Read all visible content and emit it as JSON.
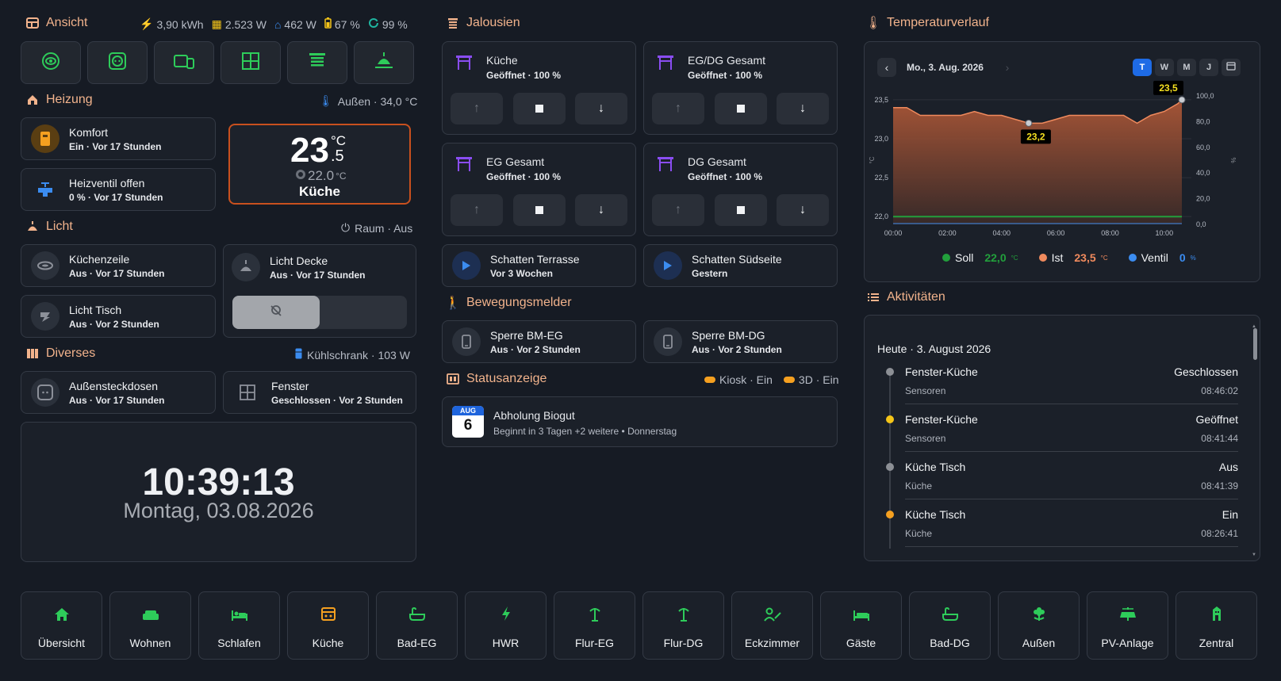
{
  "view": {
    "title": "Ansicht",
    "stats": [
      {
        "icon": "solar-energy-icon",
        "value": "3,90 kWh"
      },
      {
        "icon": "solar-panel-icon",
        "value": "2.523 W"
      },
      {
        "icon": "house-power-icon",
        "value": "462 W"
      },
      {
        "icon": "battery-icon",
        "value": "67 %"
      },
      {
        "icon": "ring-progress-icon",
        "value": "99 %"
      }
    ],
    "buttons": [
      "eye-icon",
      "socket-icon",
      "devices-icon",
      "window-icon",
      "blinds-icon",
      "ceiling-lamp-icon"
    ]
  },
  "heating": {
    "title": "Heizung",
    "outside": "Außen · 34,0 °C",
    "comfort": {
      "name": "Komfort",
      "state": "Ein · Vor 17 Stunden"
    },
    "valve": {
      "name": "Heizventil offen",
      "state": "0 % · Vor 17 Stunden"
    },
    "thermostat": {
      "temp_int": "23",
      "temp_dec": ".5",
      "unit": "°C",
      "target": "22.0",
      "target_unit": "°C",
      "room": "Küche"
    }
  },
  "light": {
    "title": "Licht",
    "room_state": "Raum · Aus",
    "kitchen_row": {
      "name": "Küchenzeile",
      "state": "Aus · Vor 17 Stunden"
    },
    "table": {
      "name": "Licht Tisch",
      "state": "Aus · Vor 2 Stunden"
    },
    "ceiling": {
      "name": "Licht Decke",
      "state": "Aus · Vor 17 Stunden"
    }
  },
  "misc": {
    "title": "Diverses",
    "fridge": "Kühlschrank · 103 W",
    "outlets": {
      "name": "Außensteckdosen",
      "state": "Aus · Vor 17 Stunden"
    },
    "window": {
      "name": "Fenster",
      "state": "Geschlossen · Vor 2 Stunden"
    }
  },
  "clock": {
    "time": "10:39:13",
    "date": "Montag, 03.08.2026"
  },
  "blinds": {
    "title": "Jalousien",
    "items": [
      {
        "name": "Küche",
        "state": "Geöffnet · 100 %"
      },
      {
        "name": "EG/DG Gesamt",
        "state": "Geöffnet · 100 %"
      },
      {
        "name": "EG Gesamt",
        "state": "Geöffnet · 100 %"
      },
      {
        "name": "DG Gesamt",
        "state": "Geöffnet · 100 %"
      }
    ],
    "scenes": [
      {
        "name": "Schatten Terrasse",
        "state": "Vor 3 Wochen"
      },
      {
        "name": "Schatten Südseite",
        "state": "Gestern"
      }
    ]
  },
  "motion": {
    "title": "Bewegungsmelder",
    "items": [
      {
        "name": "Sperre BM-EG",
        "state": "Aus · Vor 2 Stunden"
      },
      {
        "name": "Sperre BM-DG",
        "state": "Aus · Vor 2 Stunden"
      }
    ]
  },
  "status": {
    "title": "Statusanzeige",
    "kiosk": "Kiosk · Ein",
    "threed": "3D · Ein",
    "event": {
      "month": "AUG",
      "day": "6",
      "title": "Abholung Biogut",
      "detail": "Beginnt in 3 Tagen +2 weitere • Donnerstag"
    }
  },
  "temperature": {
    "title": "Temperaturverlauf",
    "date": "Mo., 3. Aug. 2026",
    "ranges": [
      "T",
      "W",
      "M",
      "J"
    ],
    "active_range": "T",
    "legend": [
      {
        "name": "Soll",
        "value": "22,0",
        "unit": "°C",
        "color": "#22a03c"
      },
      {
        "name": "Ist",
        "value": "23,5",
        "unit": "°C",
        "color": "#f08a5d"
      },
      {
        "name": "Ventil",
        "value": "0",
        "unit": "%",
        "color": "#3b8cf0"
      }
    ]
  },
  "chart_data": {
    "type": "area",
    "x": [
      "00:00",
      "00:30",
      "01:00",
      "01:30",
      "02:00",
      "02:30",
      "03:00",
      "03:30",
      "04:00",
      "04:30",
      "05:00",
      "05:30",
      "06:00",
      "06:30",
      "07:00",
      "07:30",
      "08:00",
      "08:30",
      "09:00",
      "09:30",
      "10:00",
      "10:30",
      "10:39"
    ],
    "xticks": [
      "00:00",
      "02:00",
      "04:00",
      "06:00",
      "08:00",
      "10:00"
    ],
    "ylim": [
      21.9,
      23.55
    ],
    "yticks": [
      "22,0",
      "22,5",
      "23,0",
      "23,5"
    ],
    "ylabel": "°C",
    "y2lim": [
      0,
      100
    ],
    "y2ticks": [
      "0,0",
      "20,0",
      "40,0",
      "60,0",
      "80,0",
      "100,0"
    ],
    "y2label": "%",
    "series": [
      {
        "name": "Ist",
        "color": "#f08a5d",
        "values": [
          23.4,
          23.4,
          23.3,
          23.3,
          23.3,
          23.3,
          23.35,
          23.3,
          23.3,
          23.25,
          23.2,
          23.2,
          23.25,
          23.3,
          23.3,
          23.3,
          23.3,
          23.3,
          23.2,
          23.3,
          23.35,
          23.45,
          23.5
        ]
      },
      {
        "name": "Soll",
        "color": "#22a03c",
        "values": [
          22.0,
          22.0,
          22.0,
          22.0,
          22.0,
          22.0,
          22.0,
          22.0,
          22.0,
          22.0,
          22.0,
          22.0,
          22.0,
          22.0,
          22.0,
          22.0,
          22.0,
          22.0,
          22.0,
          22.0,
          22.0,
          22.0,
          22.0
        ]
      },
      {
        "name": "Ventil",
        "color": "#3b8cf0",
        "values": [
          0,
          0,
          0,
          0,
          0,
          0,
          0,
          0,
          0,
          0,
          0,
          0,
          0,
          0,
          0,
          0,
          0,
          0,
          0,
          0,
          0,
          0,
          0
        ]
      }
    ],
    "annotations": [
      {
        "x": "05:00",
        "label": "23,2"
      },
      {
        "x": "10:39",
        "label": "23,5"
      }
    ]
  },
  "activities": {
    "title": "Aktivitäten",
    "day": "Heute · 3. August 2026",
    "items": [
      {
        "name": "Fenster-Küche",
        "state": "Geschlossen",
        "area": "Sensoren",
        "time": "08:46:02",
        "color": "#8c8f95"
      },
      {
        "name": "Fenster-Küche",
        "state": "Geöffnet",
        "area": "Sensoren",
        "time": "08:41:44",
        "color": "#f5c518"
      },
      {
        "name": "Küche Tisch",
        "state": "Aus",
        "area": "Küche",
        "time": "08:41:39",
        "color": "#8c8f95"
      },
      {
        "name": "Küche Tisch",
        "state": "Ein",
        "area": "Küche",
        "time": "08:26:41",
        "color": "#f5a020"
      }
    ]
  },
  "nav": [
    {
      "label": "Übersicht",
      "icon": "home-icon"
    },
    {
      "label": "Wohnen",
      "icon": "sofa-icon"
    },
    {
      "label": "Schlafen",
      "icon": "bed-icon"
    },
    {
      "label": "Küche",
      "icon": "stove-icon"
    },
    {
      "label": "Bad-EG",
      "icon": "bathtub-icon"
    },
    {
      "label": "HWR",
      "icon": "lightning-icon"
    },
    {
      "label": "Flur-EG",
      "icon": "coat-rack-icon"
    },
    {
      "label": "Flur-DG",
      "icon": "coat-rack-icon"
    },
    {
      "label": "Eckzimmer",
      "icon": "desk-icon"
    },
    {
      "label": "Gäste",
      "icon": "guest-bed-icon"
    },
    {
      "label": "Bad-DG",
      "icon": "bathtub-icon"
    },
    {
      "label": "Außen",
      "icon": "flower-icon"
    },
    {
      "label": "PV-Anlage",
      "icon": "solar-panel-icon"
    },
    {
      "label": "Zentral",
      "icon": "building-icon"
    }
  ]
}
